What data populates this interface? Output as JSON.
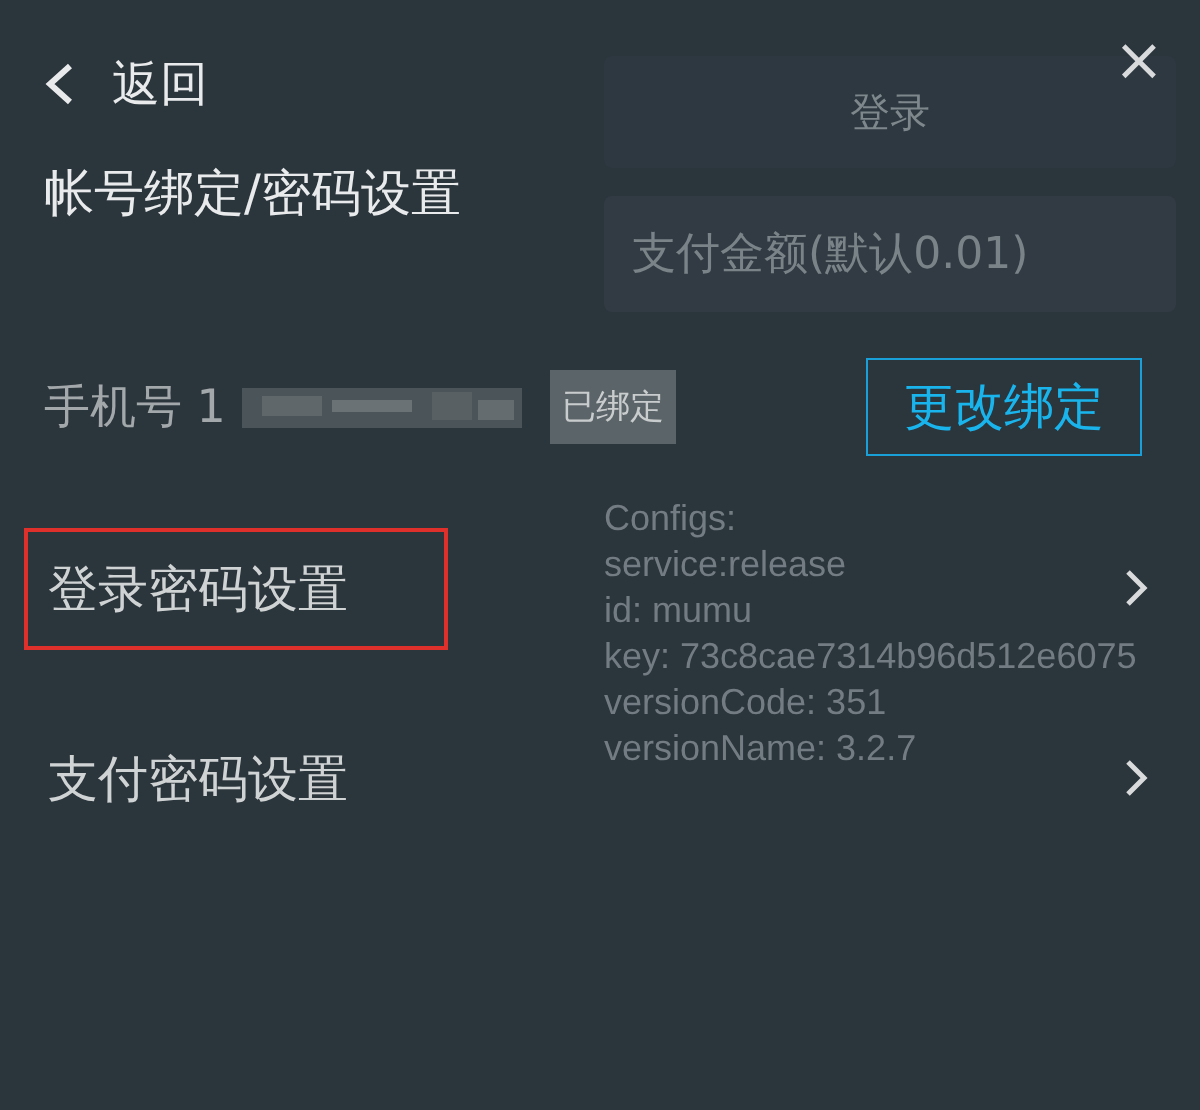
{
  "background": {
    "login_button": "登录",
    "amount_field": {
      "placeholder": "支付金额(默认0.01)"
    },
    "config_lines": [
      "Configs:",
      "service:release",
      "id: mumu",
      "key: 73c8cae7314b96d512e6075",
      "versionCode: 351",
      "versionName: 3.2.7"
    ]
  },
  "header": {
    "back": "返回",
    "close": "×"
  },
  "title": "帐号绑定/密码设置",
  "phone": {
    "label": "手机号 1",
    "badge": "已绑定",
    "button": "更改绑定"
  },
  "rows": [
    {
      "label": "登录密码设置",
      "highlighted": true
    },
    {
      "label": "支付密码设置",
      "highlighted": false
    }
  ]
}
